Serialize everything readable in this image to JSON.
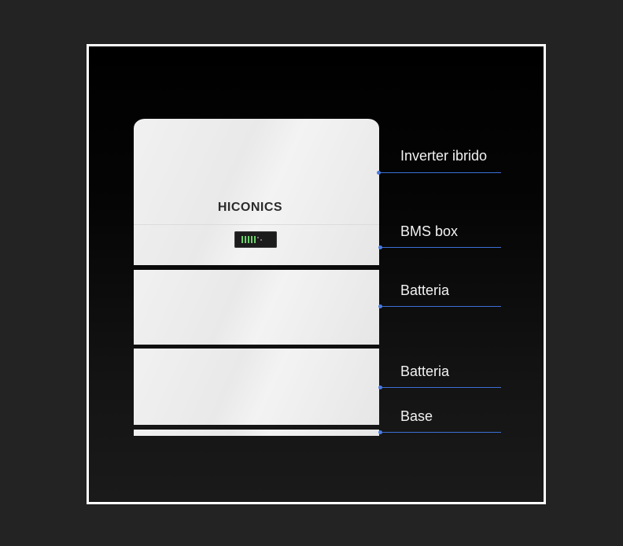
{
  "brand": "HICONICS",
  "device_status_leds": 7,
  "device_status_leds_lit": 5,
  "labels": {
    "inverter": "Inverter ibrido",
    "bms": "BMS box",
    "battery_1": "Batteria",
    "battery_2": "Batteria",
    "base": "Base"
  },
  "colors": {
    "background": "#232323",
    "frame_border": "#ffffff",
    "callout_line": "#3d6fd6",
    "module_body": "#ececec",
    "label_text": "#f2f2f2",
    "led_lit": "#6cd36c"
  }
}
